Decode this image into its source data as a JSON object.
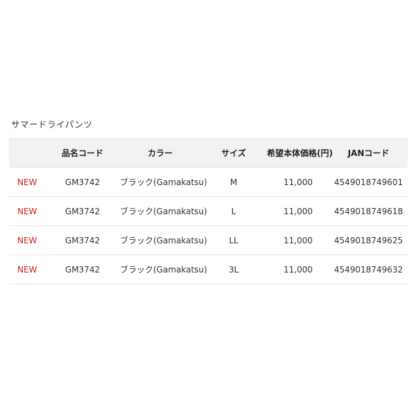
{
  "product": {
    "title": "サマードライパンツ"
  },
  "table": {
    "headers": [
      "",
      "品名コード",
      "カラー",
      "サイズ",
      "希望本体価格(円)",
      "JANコード"
    ],
    "rows": [
      {
        "badge": "NEW",
        "code": "GM3742",
        "color": "ブラック(Gamakatsu)",
        "size": "M",
        "price": "11,000",
        "jan": "4549018749601"
      },
      {
        "badge": "NEW",
        "code": "GM3742",
        "color": "ブラック(Gamakatsu)",
        "size": "L",
        "price": "11,000",
        "jan": "4549018749618"
      },
      {
        "badge": "NEW",
        "code": "GM3742",
        "color": "ブラック(Gamakatsu)",
        "size": "LL",
        "price": "11,000",
        "jan": "4549018749625"
      },
      {
        "badge": "NEW",
        "code": "GM3742",
        "color": "ブラック(Gamakatsu)",
        "size": "3L",
        "price": "11,000",
        "jan": "4549018749632"
      }
    ]
  },
  "colors": {
    "new_badge": "#cc1e1e",
    "header_background": "#f2f2f2",
    "row_divider": "#e6e6e6"
  }
}
